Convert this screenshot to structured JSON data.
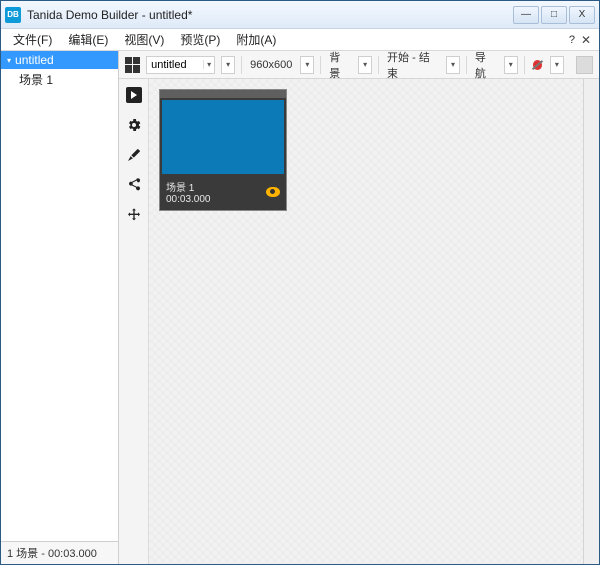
{
  "window": {
    "title": "Tanida Demo Builder - untitled*",
    "icon_abbr": "DB"
  },
  "window_buttons": {
    "min": "—",
    "max": "□",
    "close": "X"
  },
  "menubar": {
    "items": [
      {
        "label": "文件(F)"
      },
      {
        "label": "编辑(E)"
      },
      {
        "label": "视图(V)"
      },
      {
        "label": "预览(P)"
      },
      {
        "label": "附加(A)"
      }
    ],
    "help": "?",
    "close": "✕"
  },
  "sidebar": {
    "root": {
      "label": "untitled"
    },
    "items": [
      {
        "label": "场景 1"
      }
    ],
    "status": "1 场景 - 00:03.000"
  },
  "toolbar": {
    "project_name": "untitled",
    "resolution": "960x600",
    "background": "背景",
    "playback": "开始 - 结束",
    "navigation": "导航"
  },
  "scene": {
    "name": "场景 1",
    "duration": "00:03.000"
  }
}
